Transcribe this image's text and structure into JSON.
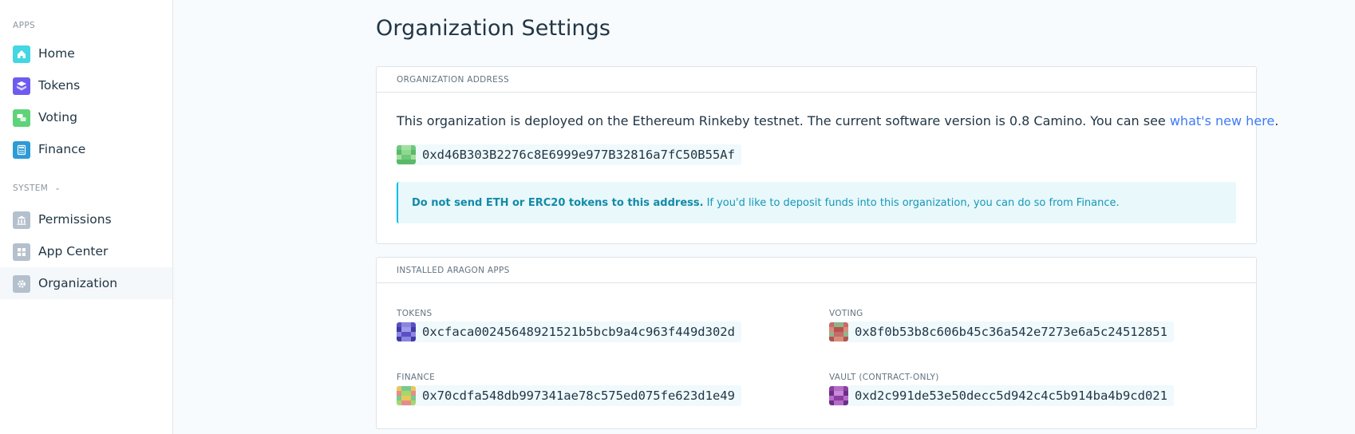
{
  "sidebar": {
    "apps_label": "APPS",
    "apps": [
      {
        "label": "Home",
        "icon": "home-icon",
        "color": "#43d6e3"
      },
      {
        "label": "Tokens",
        "icon": "tokens-icon",
        "color": "#6e5cf0"
      },
      {
        "label": "Voting",
        "icon": "voting-icon",
        "color": "#5fd37a"
      },
      {
        "label": "Finance",
        "icon": "finance-icon",
        "color": "#2d9bd6"
      }
    ],
    "system_label": "SYSTEM",
    "system": [
      {
        "label": "Permissions",
        "icon": "permissions-icon",
        "color": "#b4c0cc"
      },
      {
        "label": "App Center",
        "icon": "app-center-icon",
        "color": "#b4c0cc"
      },
      {
        "label": "Organization",
        "icon": "organization-icon",
        "color": "#b4c0cc"
      }
    ]
  },
  "page": {
    "title": "Organization Settings"
  },
  "org_card": {
    "header": "ORGANIZATION ADDRESS",
    "description_text": "This organization is deployed on the Ethereum Rinkeby testnet. The current software version is 0.8 Camino. You can see ",
    "description_link": "what's new here",
    "description_end": ".",
    "address": "0xd46B303B2276c8E6999e977B32816a7fC50B55Af",
    "notice_bold": "Do not send ETH or ERC20 tokens to this address.",
    "notice_text": "If you'd like to deposit funds into this organization, you can do so from",
    "notice_link": "Finance",
    "notice_end": "."
  },
  "apps_card": {
    "header": "INSTALLED ARAGON APPS",
    "apps": [
      {
        "label": "TOKENS",
        "address": "0xcfaca00245648921521b5bcb9a4c963f449d302d"
      },
      {
        "label": "VOTING",
        "address": "0x8f0b53b8c606b45c36a542e7273e6a5c24512851"
      },
      {
        "label": "FINANCE",
        "address": "0x70cdfa548db997341ae78c575ed075fe623d1e49"
      },
      {
        "label": "VAULT (CONTRACT-ONLY)",
        "address": "0xd2c991de53e50decc5d942c4c5b914ba4b9cd021"
      }
    ]
  },
  "colors": {
    "accent": "#3e7bf6",
    "notice_border": "#08bee5",
    "notice_bg": "#e8f8fb"
  }
}
